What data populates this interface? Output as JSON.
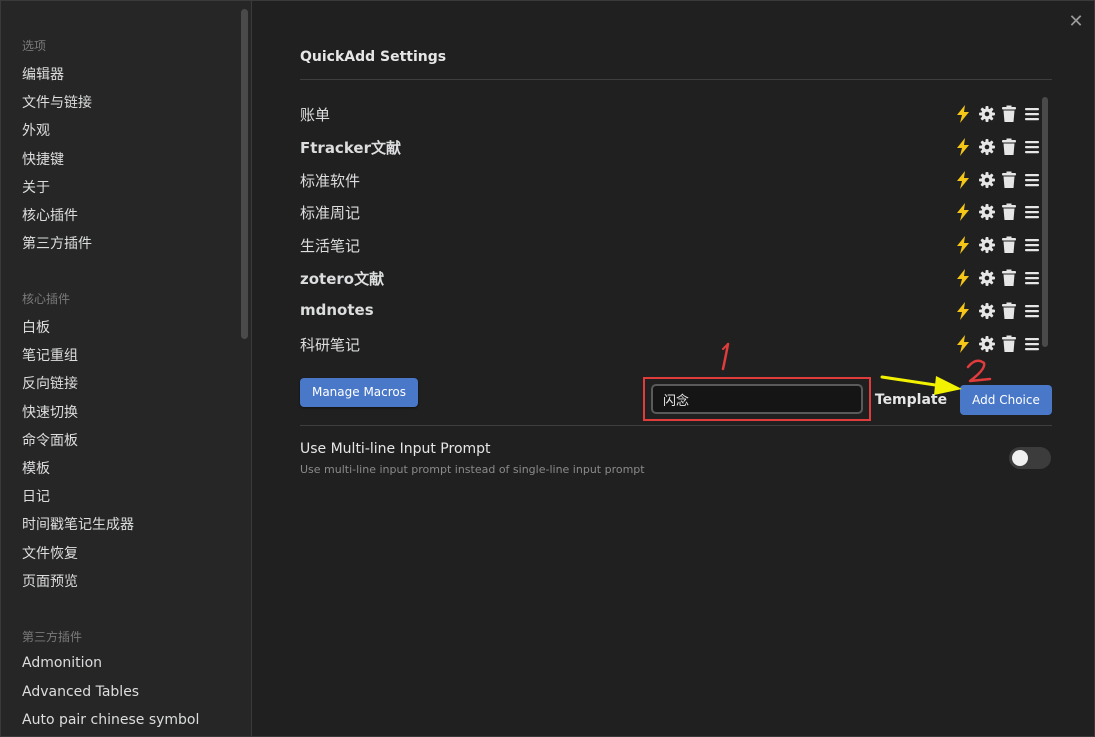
{
  "window": {
    "close_glyph": "✕"
  },
  "sidebar": {
    "groups": [
      {
        "title": "选项",
        "items": [
          "编辑器",
          "文件与链接",
          "外观",
          "快捷键",
          "关于",
          "核心插件",
          "第三方插件"
        ]
      },
      {
        "title": "核心插件",
        "items": [
          "白板",
          "笔记重组",
          "反向链接",
          "快速切换",
          "命令面板",
          "模板",
          "日记",
          "时间戳笔记生成器",
          "文件恢复",
          "页面预览"
        ]
      },
      {
        "title": "第三方插件",
        "items": [
          "Admonition",
          "Advanced Tables",
          "Auto pair chinese symbol"
        ]
      }
    ]
  },
  "settings": {
    "title": "QuickAdd Settings",
    "choices": [
      {
        "name": "账单",
        "bold": false
      },
      {
        "name": "Ftracker文献",
        "bold": true
      },
      {
        "name": "标准软件",
        "bold": false
      },
      {
        "name": "标准周记",
        "bold": false
      },
      {
        "name": "生活笔记",
        "bold": false
      },
      {
        "name": "zotero文献",
        "bold": true
      },
      {
        "name": "mdnotes",
        "bold": true
      },
      {
        "name": "科研笔记",
        "bold": false
      }
    ],
    "choice_icons": [
      "bolt-icon",
      "gear-icon",
      "trash-icon",
      "drag-handle-icon"
    ],
    "manage_macros_label": "Manage Macros",
    "new_choice_value": "闪念",
    "choice_type_label": "Template",
    "add_choice_label": "Add Choice",
    "multiline": {
      "name": "Use Multi-line Input Prompt",
      "description": "Use multi-line input prompt instead of single-line input prompt",
      "enabled": false
    }
  },
  "annotations": {
    "step1": "1",
    "step2": "2"
  },
  "colors": {
    "accent": "#4a78c9",
    "bolt": "#f5c518",
    "annotation_red": "#e03c3c",
    "annotation_yellow": "#f2f200"
  }
}
